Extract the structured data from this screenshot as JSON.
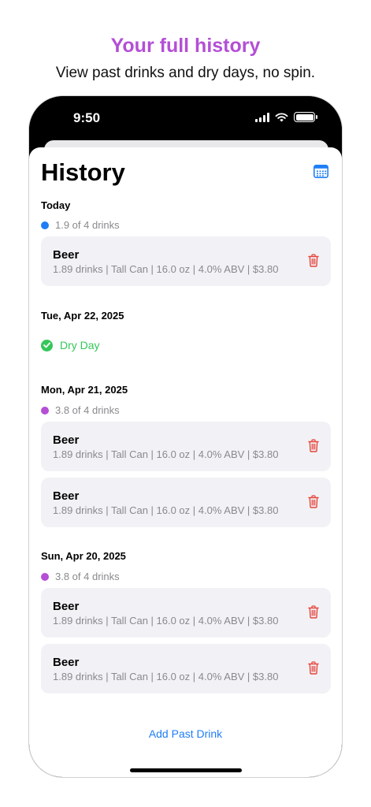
{
  "promo": {
    "title": "Your full history",
    "subtitle": "View past drinks and dry days, no spin."
  },
  "status_bar": {
    "time": "9:50",
    "icons": [
      "signal-icon",
      "wifi-icon",
      "battery-icon"
    ]
  },
  "header": {
    "title": "History",
    "calendar_icon": "calendar-icon"
  },
  "colors": {
    "accent": "#1f7ef7",
    "promo": "#b44fd6",
    "dot_blue": "#1f7ef7",
    "dot_purple": "#b44fd6",
    "dry_green": "#34c759",
    "trash_red": "#e5453b"
  },
  "sections": [
    {
      "date": "Today",
      "summary": "1.9 of 4 drinks",
      "dot_color": "#1f7ef7",
      "entries": [
        {
          "name": "Beer",
          "detail": "1.89 drinks | Tall Can | 16.0 oz | 4.0% ABV | $3.80"
        }
      ]
    },
    {
      "date": "Tue, Apr 22, 2025",
      "dry_label": "Dry Day"
    },
    {
      "date": "Mon, Apr 21, 2025",
      "summary": "3.8 of 4 drinks",
      "dot_color": "#b44fd6",
      "entries": [
        {
          "name": "Beer",
          "detail": "1.89 drinks | Tall Can | 16.0 oz | 4.0% ABV | $3.80"
        },
        {
          "name": "Beer",
          "detail": "1.89 drinks | Tall Can | 16.0 oz | 4.0% ABV | $3.80"
        }
      ]
    },
    {
      "date": "Sun, Apr 20, 2025",
      "summary": "3.8 of 4 drinks",
      "dot_color": "#b44fd6",
      "entries": [
        {
          "name": "Beer",
          "detail": "1.89 drinks | Tall Can | 16.0 oz | 4.0% ABV | $3.80"
        },
        {
          "name": "Beer",
          "detail": "1.89 drinks | Tall Can | 16.0 oz | 4.0% ABV | $3.80"
        }
      ]
    }
  ],
  "footer": {
    "add_past_label": "Add Past Drink"
  }
}
